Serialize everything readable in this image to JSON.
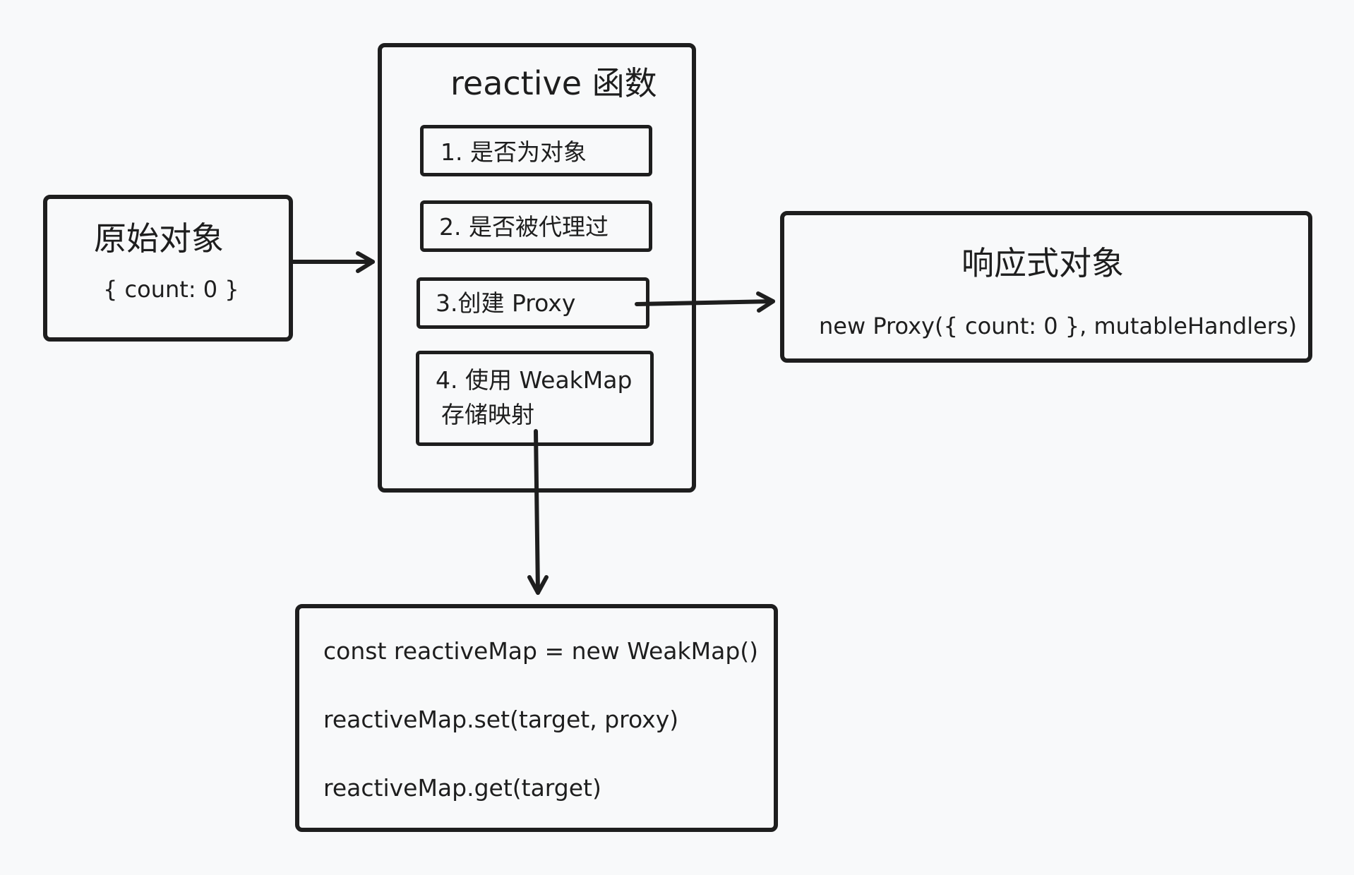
{
  "original_object": {
    "title": "原始对象",
    "value": "{ count: 0 }"
  },
  "reactive_function": {
    "title": "reactive 函数",
    "steps": [
      "1. 是否为对象",
      "2. 是否被代理过",
      "3.创建 Proxy",
      "4. 使用 WeakMap",
      "存储映射"
    ]
  },
  "reactive_object": {
    "title": "响应式对象",
    "value": "new Proxy({ count: 0 }, mutableHandlers)"
  },
  "weakmap_code": {
    "lines": [
      "const reactiveMap = new WeakMap()",
      "reactiveMap.set(target, proxy)",
      "reactiveMap.get(target)"
    ]
  },
  "colors": {
    "background": "#f8f9fa",
    "stroke": "#1e1e1e"
  }
}
